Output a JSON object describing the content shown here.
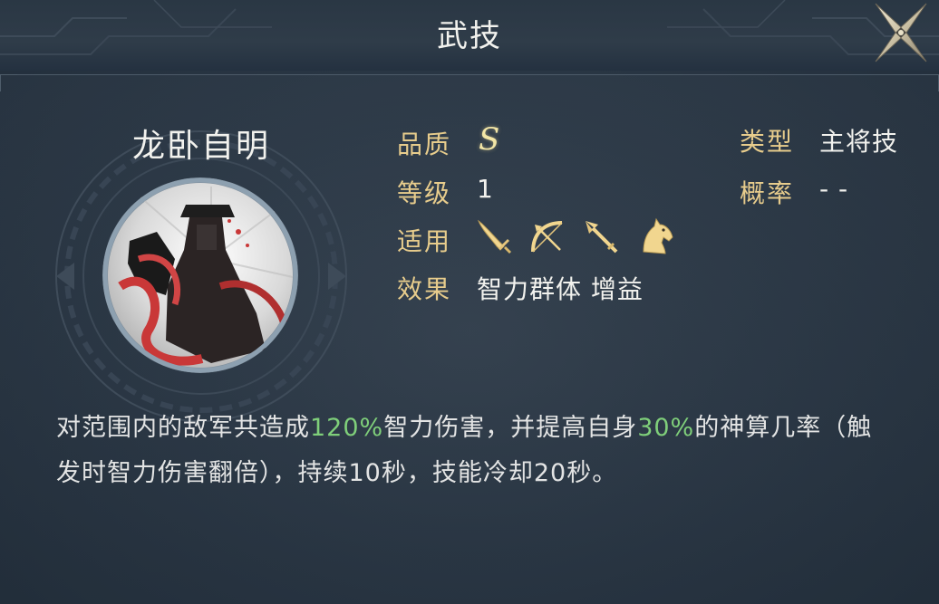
{
  "header": {
    "title": "武技"
  },
  "skill": {
    "name": "龙卧自明"
  },
  "info": {
    "quality_label": "品质",
    "quality_value": "S",
    "level_label": "等级",
    "level_value": "1",
    "apply_label": "适用",
    "effect_label": "效果",
    "effect_value": "智力群体 增益",
    "type_label": "类型",
    "type_value": "主将技",
    "chance_label": "概率",
    "chance_value": "- -"
  },
  "troop_icons": [
    "sword-icon",
    "bow-icon",
    "spear-icon",
    "horse-icon"
  ],
  "description": {
    "part1": "对范围内的敌军共造成",
    "highlight1": "120%",
    "part2": "智力伤害，并提高自身",
    "highlight2": "30%",
    "part3": "的神算几率（触发时智力伤害翻倍），持续10秒，技能冷却20秒。"
  },
  "colors": {
    "label_gold": "#e7cc8c",
    "highlight_green": "#7fcf7a",
    "text_white": "#f2f2ee",
    "background": "#2b3846"
  }
}
